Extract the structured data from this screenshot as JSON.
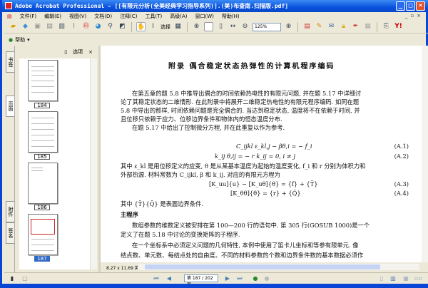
{
  "window": {
    "title": "Adobe Acrobat Professional - [[有限元分析(全美经典学习指导系列)].(美)布查南.扫描版.pdf]",
    "minimize": "_",
    "maximize": "□",
    "close": "×"
  },
  "menu": [
    "文件(F)",
    "编辑(E)",
    "视图(V)",
    "文档(D)",
    "注释(C)",
    "工具(T)",
    "高级(A)",
    "窗口(W)",
    "帮助(H)"
  ],
  "toolbar": {
    "select_label": "选择",
    "zoom_value": "125%"
  },
  "toolbar2": {
    "help_label": "帮助"
  },
  "side_tabs": [
    "书签",
    "页面",
    "附件",
    "签名"
  ],
  "panel": {
    "options_label": "选项",
    "close": "×",
    "thumbnails": [
      "184",
      "185",
      "186",
      "187"
    ],
    "selected": "187"
  },
  "document": {
    "title": "附录   偶合稳定状态热弹性的计算机程序编码",
    "p1": [
      "在第五章的题 5.8 中推导出偶合的时间依赖热电性的有限元问题, 并在题 5.17 中详细讨",
      "论了其稳定状态的二维情形. 在此附录中将展开二维稳定热电性的有限元程序编码. 如同在题",
      "5.8 中导出的那样, 时间依赖问题是完全偶合的. 当达到稳定状态, 温度将不在依赖于时间, 并",
      "且位移只依赖于应力、位移边界条件和物体内的恒态温度分布."
    ],
    "p2": "在题 5.17 中给出了控制微分方程, 并在此重复以作为参考.",
    "eq1": "C_ijkl ε_kl,j − βθ,i = − f_i",
    "eq1_num": "(A.1)",
    "eq2": "k_ij θ,ij = − r      k_ij = 0,      i ≠ j",
    "eq2_num": "(A.2)",
    "p3": [
      "其中 ε_kl 是用位移定义的应变, θ 是从某基本温度为起始的温度变化, f_i 和 r 分别为体积力和",
      "外部热源. 材料常数为 C_ijkl, β 和 k_ij. 对应的有限元方程为"
    ],
    "eq3": "[K_uu]{u} − [K_uθ]{θ} = {f} + {T̄}",
    "eq3_num": "(A.3)",
    "eq4": "[K_θθ]{θ} = {r} + {Q̄}",
    "eq4_num": "(A.4)",
    "p4": "其中 {T̄}{Q̄} 是表面边界条件.",
    "heading": "主程序",
    "p5": [
      "数组参数的维数定义被安排在第 100—200 行的语句中. 第 305 行(GOSUB 1000)是一个",
      "定义了在题 5.18 中讨论的变换矩阵的子程序."
    ],
    "p6": [
      "在一个坐标系中必须定义问题的几何特性, 本例中使用了笛卡儿坐标和等参有限单元. 像",
      "结点数、单元数、每结点处的自由度、不同的材料参数的个数和边界条件数的基本数据必须作"
    ]
  },
  "page_size": "8.27 x 11.69 英寸",
  "status": {
    "page_input": "第 187 / 202 页"
  }
}
